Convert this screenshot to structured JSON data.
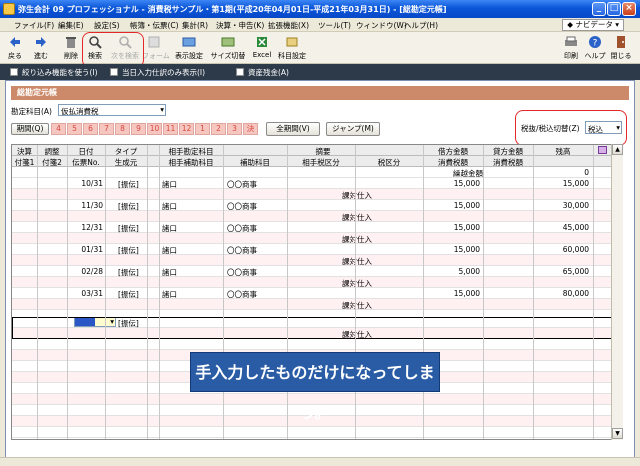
{
  "window": {
    "title": "弥生会計 09 プロフェッショナル - 消費税サンプル・第1期(平成20年04月01日-平成21年03月31日) - [総勘定元帳]"
  },
  "menu": {
    "items": [
      "ファイル(F)",
      "編集(E)",
      "設定(S)",
      "帳簿・伝票(C)",
      "集計(R)",
      "決算・申告(K)",
      "拡張機能(X)",
      "ツール(T)",
      "ウィンドウ(W)",
      "ヘルプ(H)"
    ],
    "navi": "ナビデータ"
  },
  "toolbar": {
    "back": "戻る",
    "forward": "進む",
    "delete": "削除",
    "search": "検索",
    "search_next": "次を検索",
    "form": "フォーム",
    "display_settings": "表示設定",
    "size_toggle": "サイズ切替",
    "excel": "Excel",
    "account_settings": "科目設定",
    "print": "印刷",
    "help": "ヘルプ",
    "close": "閉じる"
  },
  "options": {
    "filter": "絞り込み機能を使う(I)",
    "today_only": "当日入力仕訳のみ表示(I)",
    "closing": "資産残金(A)"
  },
  "section_title": "総勘定元帳",
  "account": {
    "label": "勘定科目(A)",
    "value": "仮払消費税"
  },
  "tax_toggle": {
    "label": "税抜/税込切替(Z)",
    "value": "税込"
  },
  "period": {
    "label": "期間(Q)",
    "months": [
      "4",
      "5",
      "6",
      "7",
      "8",
      "9",
      "10",
      "11",
      "12",
      "1",
      "2",
      "3",
      "決"
    ],
    "all_button": "全期間(V)",
    "jump_button": "ジャンプ(M)"
  },
  "grid": {
    "header1": [
      "決算",
      "調整",
      "日付",
      "タイプ",
      "相手勘定科目",
      "摘要",
      "借方金額",
      "貸方金額",
      "残高"
    ],
    "header2": [
      "付箋1",
      "付箋2",
      "伝票No.",
      "生成元",
      "相手補助科目",
      "補助科目",
      "相手税区分",
      "税区分",
      "消費税額",
      "消費税額"
    ],
    "carry_label": "繰越金額",
    "carry_value": "0",
    "rows": [
      {
        "date": "10/31",
        "type": "[振伝]",
        "account": "諸口",
        "memo": "〇〇商事",
        "tax": "課対仕入",
        "debit": "15,000",
        "balance": "15,000"
      },
      {
        "date": "11/30",
        "type": "[振伝]",
        "account": "諸口",
        "memo": "〇〇商事",
        "tax": "課対仕入",
        "debit": "15,000",
        "balance": "30,000"
      },
      {
        "date": "12/31",
        "type": "[振伝]",
        "account": "諸口",
        "memo": "〇〇商事",
        "tax": "課対仕入",
        "debit": "15,000",
        "balance": "45,000"
      },
      {
        "date": "01/31",
        "type": "[振伝]",
        "account": "諸口",
        "memo": "〇〇商事",
        "tax": "課対仕入",
        "debit": "15,000",
        "balance": "60,000"
      },
      {
        "date": "02/28",
        "type": "[振伝]",
        "account": "諸口",
        "memo": "〇〇商事",
        "tax": "課対仕入",
        "debit": "5,000",
        "balance": "65,000"
      },
      {
        "date": "03/31",
        "type": "[振伝]",
        "account": "諸口",
        "memo": "〇〇商事",
        "tax": "課対仕入",
        "debit": "15,000",
        "balance": "80,000"
      }
    ],
    "input_type": "[振伝]",
    "input_tax": "課対仕入"
  },
  "annotation": {
    "message": "手入力したものだけになってしまう。"
  },
  "colors": {
    "title_bar": "#0a55d8",
    "section_bar": "#cc8a6a",
    "row_band": "#fff0f2",
    "annotation_ring": "#e4282a",
    "message_bg": "#2a5ba5"
  }
}
